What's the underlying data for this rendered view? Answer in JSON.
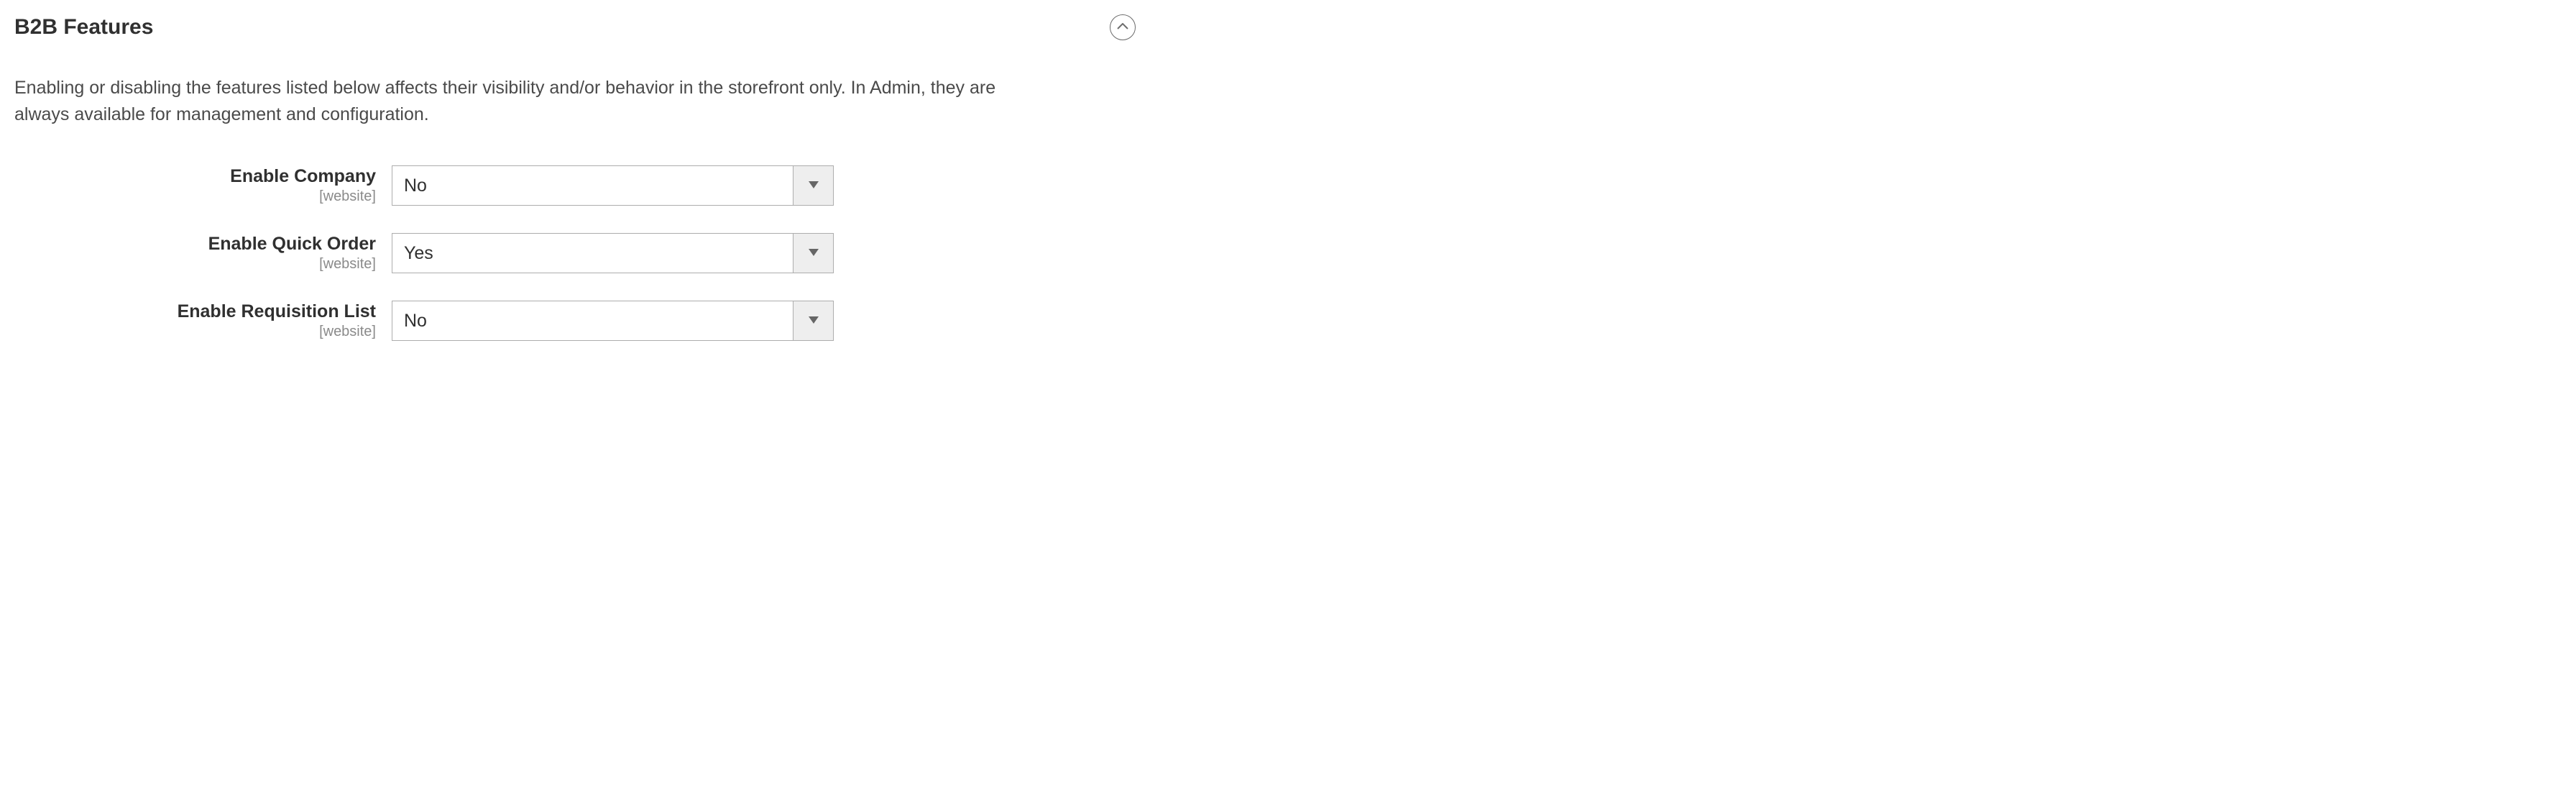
{
  "section": {
    "title": "B2B Features",
    "description": "Enabling or disabling the features listed below affects their visibility and/or behavior in the storefront only. In Admin, they are always available for management and configuration."
  },
  "fields": {
    "company": {
      "label": "Enable Company",
      "scope": "[website]",
      "value": "No"
    },
    "quick_order": {
      "label": "Enable Quick Order",
      "scope": "[website]",
      "value": "Yes"
    },
    "requisition_list": {
      "label": "Enable Requisition List",
      "scope": "[website]",
      "value": "No"
    }
  }
}
